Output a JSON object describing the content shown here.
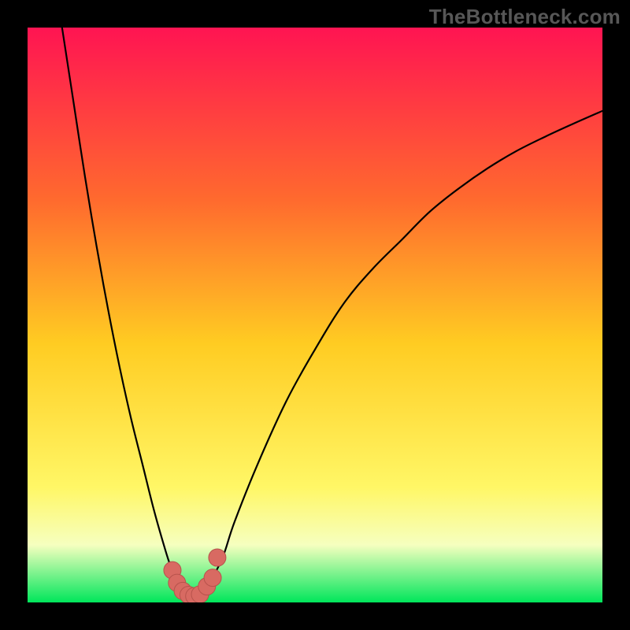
{
  "watermark": "TheBottleneck.com",
  "colors": {
    "frame": "#000000",
    "gradient_top": "#ff1452",
    "gradient_mid_upper": "#ff6a2e",
    "gradient_mid": "#ffcc22",
    "gradient_mid_lower": "#fff766",
    "gradient_band": "#f6ffbf",
    "gradient_bottom": "#00e65b",
    "curve": "#000000",
    "marker_fill": "#d86a62",
    "marker_stroke": "#b7534c"
  },
  "chart_data": {
    "type": "line",
    "title": "",
    "xlabel": "",
    "ylabel": "",
    "xlim": [
      0,
      100
    ],
    "ylim": [
      0,
      100
    ],
    "series": [
      {
        "name": "bottleneck-curve-left",
        "x": [
          6,
          8,
          10,
          12,
          14,
          16,
          18,
          20,
          22,
          24,
          25,
          26,
          27,
          28,
          29
        ],
        "y": [
          100,
          87,
          74,
          62,
          51,
          41,
          32,
          24,
          16,
          9,
          6,
          4,
          2.3,
          1.5,
          1.1
        ]
      },
      {
        "name": "bottleneck-curve-right",
        "x": [
          29,
          30,
          31,
          32,
          34,
          36,
          40,
          45,
          50,
          55,
          60,
          65,
          70,
          75,
          80,
          85,
          90,
          95,
          100
        ],
        "y": [
          1.1,
          1.4,
          2.6,
          4,
          8,
          14,
          24,
          35,
          44,
          52,
          58,
          63,
          68,
          72,
          75.5,
          78.5,
          81,
          83.3,
          85.5
        ]
      }
    ],
    "markers": {
      "name": "highlight-points",
      "x": [
        25.2,
        26.0,
        27.0,
        28.0,
        29.0,
        30.0,
        31.2,
        32.2,
        33
      ],
      "y": [
        5.6,
        3.4,
        2.0,
        1.3,
        1.1,
        1.4,
        2.8,
        4.3,
        7.8
      ]
    }
  }
}
